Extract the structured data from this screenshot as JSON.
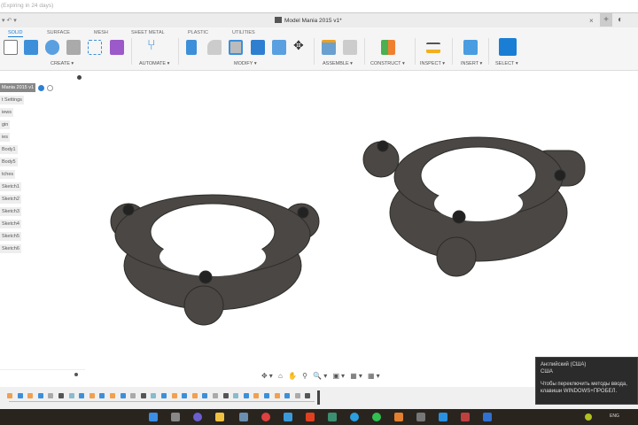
{
  "window": {
    "expiry": "(Expiring in 24 days)",
    "title": "Model Mania 2015 v1*"
  },
  "tabs": [
    "SOLID",
    "SURFACE",
    "MESH",
    "SHEET METAL",
    "PLASTIC",
    "UTILITIES"
  ],
  "groups": [
    "CREATE ▾",
    "AUTOMATE ▾",
    "MODIFY ▾",
    "ASSEMBLE ▾",
    "CONSTRUCT ▾",
    "INSPECT ▾",
    "INSERT ▾",
    "SELECT ▾"
  ],
  "browser": {
    "root": "Mania 2015 v1",
    "items": [
      "t Settings",
      "iews",
      "gin",
      "ies",
      "Body1",
      "Body5",
      "tches",
      "Sketch1",
      "Sketch2",
      "Sketch3",
      "Sketch4",
      "Sketch5",
      "Sketch6"
    ]
  },
  "tooltip": {
    "line1": "Английский (США)",
    "line2": "США",
    "line3": "Чтобы переключить методы ввода,",
    "line4": "клавиши WINDOWS+ПРОБЕЛ."
  },
  "taskbar": {
    "lang": "ENG"
  },
  "colors": {
    "accent": "#1a7fd4",
    "part": "#4a4744"
  }
}
